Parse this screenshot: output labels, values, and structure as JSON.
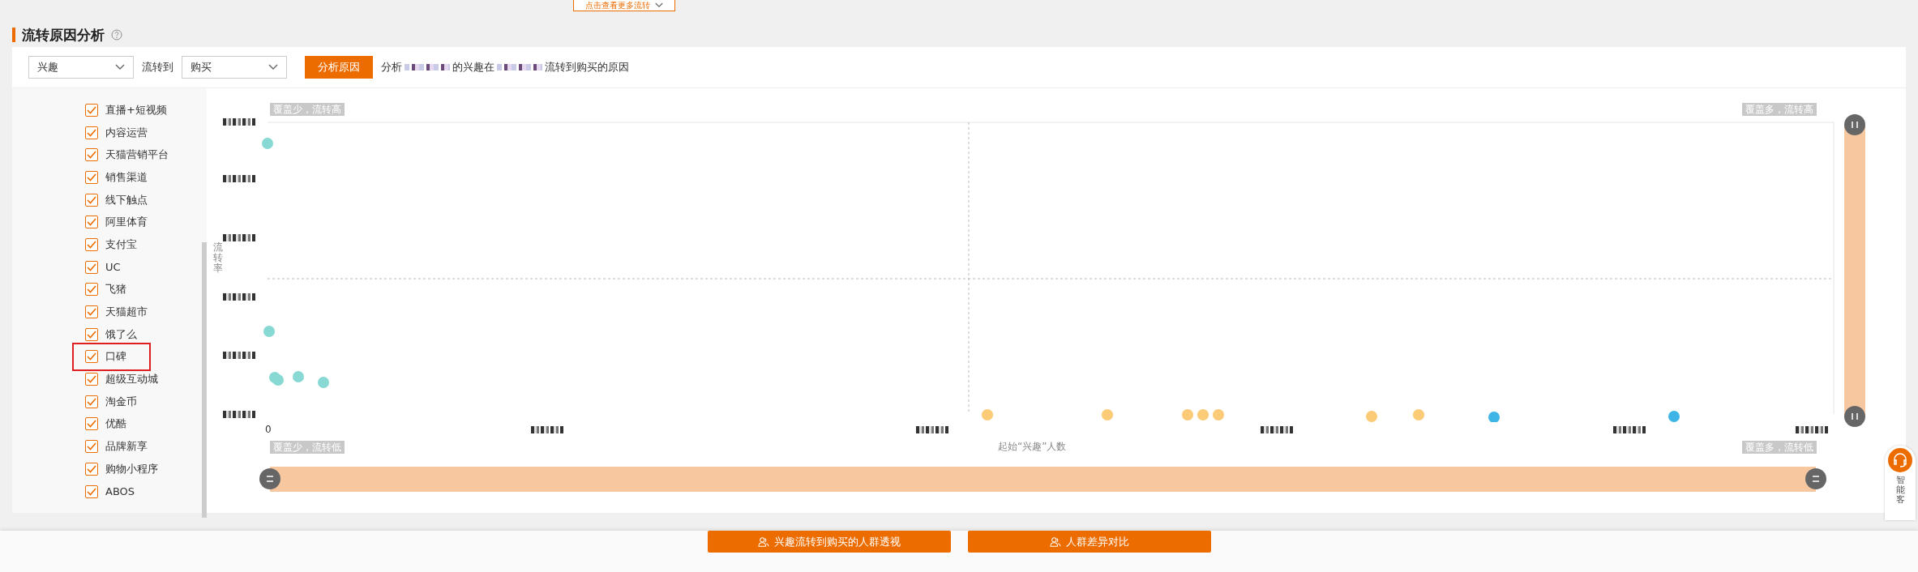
{
  "top_button": {
    "label": "点击查看更多流转"
  },
  "section": {
    "title": "流转原因分析"
  },
  "filters": {
    "from_select": {
      "value": "兴趣"
    },
    "to_label": "流转到",
    "to_select": {
      "value": "购买"
    },
    "analyze_button": "分析原因",
    "description_parts": [
      "分析",
      "的兴趣在",
      "流转到购买的原因"
    ]
  },
  "channels": [
    {
      "label": "直播+短视频",
      "checked": true,
      "highlighted": false
    },
    {
      "label": "内容运营",
      "checked": true,
      "highlighted": false
    },
    {
      "label": "天猫营销平台",
      "checked": true,
      "highlighted": false
    },
    {
      "label": "销售渠道",
      "checked": true,
      "highlighted": false
    },
    {
      "label": "线下触点",
      "checked": true,
      "highlighted": false
    },
    {
      "label": "阿里体育",
      "checked": true,
      "highlighted": false
    },
    {
      "label": "支付宝",
      "checked": true,
      "highlighted": false
    },
    {
      "label": "UC",
      "checked": true,
      "highlighted": false
    },
    {
      "label": "飞猪",
      "checked": true,
      "highlighted": false
    },
    {
      "label": "天猫超市",
      "checked": true,
      "highlighted": false
    },
    {
      "label": "饿了么",
      "checked": true,
      "highlighted": false
    },
    {
      "label": "口碑",
      "checked": true,
      "highlighted": true
    },
    {
      "label": "超级互动城",
      "checked": true,
      "highlighted": false
    },
    {
      "label": "淘金币",
      "checked": true,
      "highlighted": false
    },
    {
      "label": "优酷",
      "checked": true,
      "highlighted": false
    },
    {
      "label": "品牌新享",
      "checked": true,
      "highlighted": false
    },
    {
      "label": "购物小程序",
      "checked": true,
      "highlighted": false
    },
    {
      "label": "ABOS",
      "checked": true,
      "highlighted": false
    }
  ],
  "chart": {
    "quadrant_labels": [
      "覆盖少，流转高",
      "覆盖多，流转高",
      "覆盖少，流转低",
      "覆盖多，流转低"
    ],
    "y_title": "流转率",
    "x_title": "起始“兴趣”人数",
    "x_origin": "0",
    "vertical_range": {
      "level": 1
    },
    "horizontal_range": {
      "level": 1
    }
  },
  "actions": [
    "兴趣流转到购买的人群透视",
    "人群差异对比"
  ],
  "service": {
    "label": "智能客"
  }
}
